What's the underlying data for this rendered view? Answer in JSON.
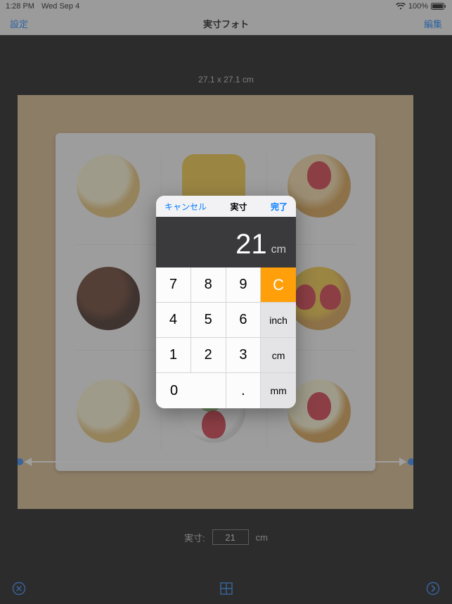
{
  "status": {
    "time": "1:28 PM",
    "date": "Wed Sep 4",
    "battery_pct": "100%"
  },
  "nav": {
    "left": "設定",
    "title": "実寸フォト",
    "right": "編集"
  },
  "main": {
    "dimensions_label": "27.1 x 27.1 cm",
    "size_label": "実寸:",
    "size_value": "21",
    "size_unit": "cm"
  },
  "popover": {
    "cancel": "キャンセル",
    "title": "実寸",
    "done": "完了",
    "display_value": "21",
    "display_unit": "cm",
    "keys": {
      "k7": "7",
      "k8": "8",
      "k9": "9",
      "clear": "C",
      "k4": "4",
      "k5": "5",
      "k6": "6",
      "inch": "inch",
      "k1": "1",
      "k2": "2",
      "k3": "3",
      "cm": "cm",
      "k0": "0",
      "dot": ".",
      "mm": "mm"
    }
  }
}
